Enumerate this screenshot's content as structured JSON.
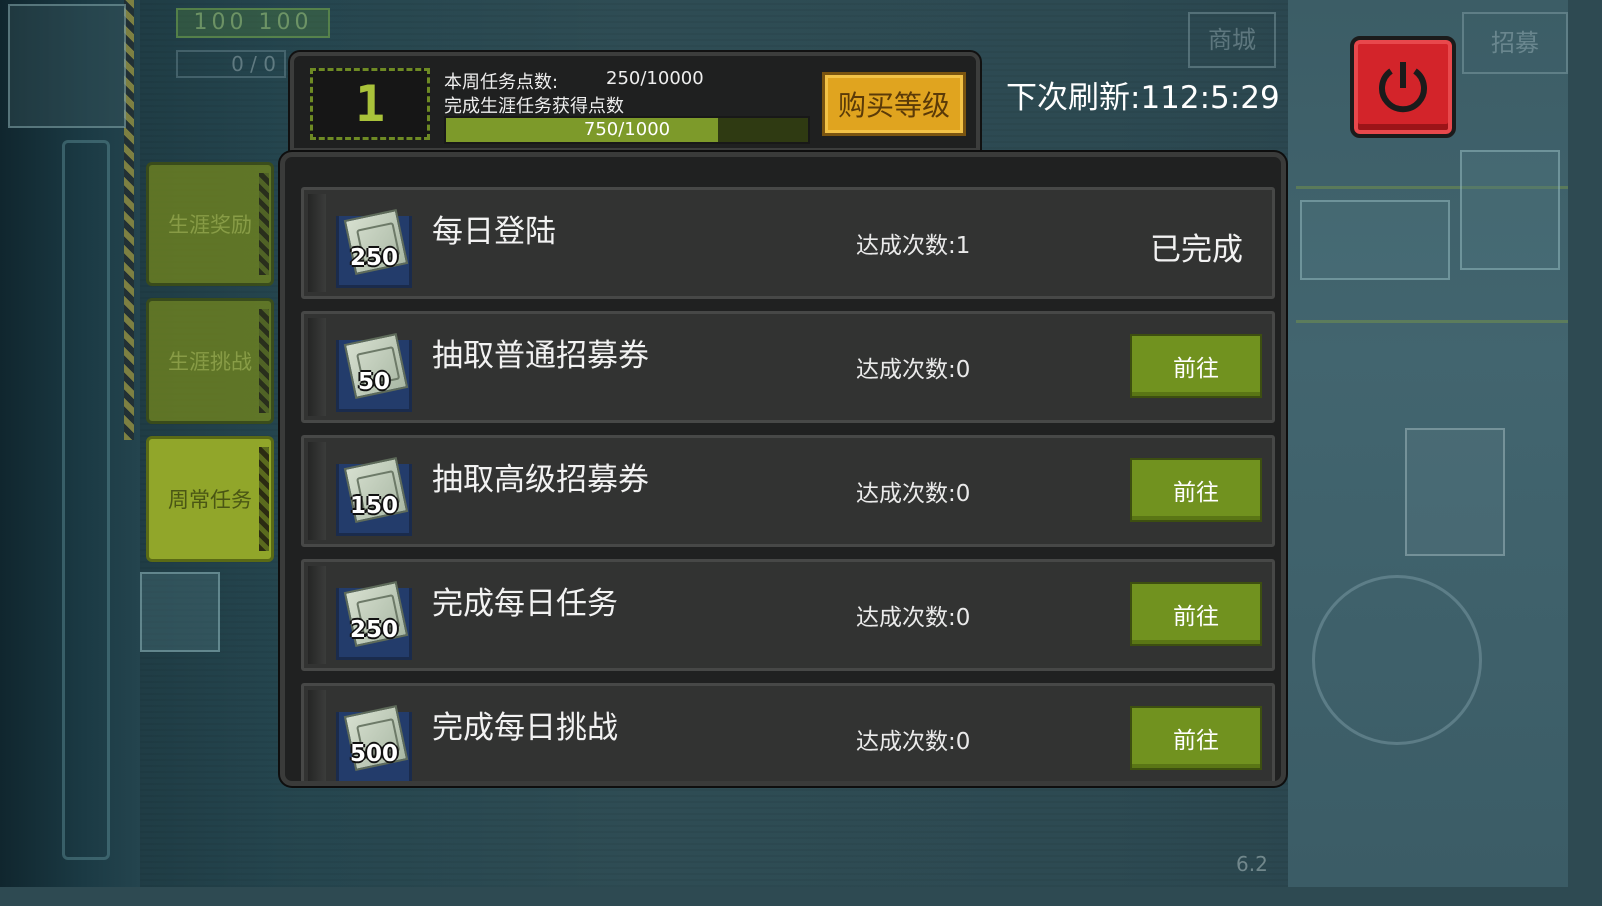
{
  "header": {
    "level": "1",
    "week_points_label": "本周任务点数:",
    "week_points_value": "250/10000",
    "career_label": "完成生涯任务获得点数",
    "career_progress_text": "750/1000",
    "career_progress_fraction": 0.75,
    "buy_level_label": "购买等级"
  },
  "refresh": {
    "label": "下次刷新:112:5:29"
  },
  "side_tabs": [
    {
      "label": "生涯奖励",
      "active": false
    },
    {
      "label": "生涯挑战",
      "active": false
    },
    {
      "label": "周常任务",
      "active": true
    }
  ],
  "background": {
    "hud_bar": "100 100",
    "hud_counter": "0 / 0",
    "shop": "商城",
    "recruit": "招募",
    "version": "6.2"
  },
  "tasks": [
    {
      "reward": "250",
      "name": "每日登陆",
      "count": "达成次数:1",
      "done": true,
      "status": "已完成"
    },
    {
      "reward": "50",
      "name": "抽取普通招募券",
      "count": "达成次数:0",
      "done": false,
      "action": "前往"
    },
    {
      "reward": "150",
      "name": "抽取高级招募券",
      "count": "达成次数:0",
      "done": false,
      "action": "前往"
    },
    {
      "reward": "250",
      "name": "完成每日任务",
      "count": "达成次数:0",
      "done": false,
      "action": "前往"
    },
    {
      "reward": "500",
      "name": "完成每日挑战",
      "count": "达成次数:0",
      "done": false,
      "action": "前往"
    }
  ],
  "colors": {
    "accent_green": "#71921f",
    "buy_gold": "#e0a41f",
    "power_red": "#d3242a",
    "panel_bg": "#202121"
  },
  "icons": [
    "power-icon",
    "ticket-icon"
  ]
}
